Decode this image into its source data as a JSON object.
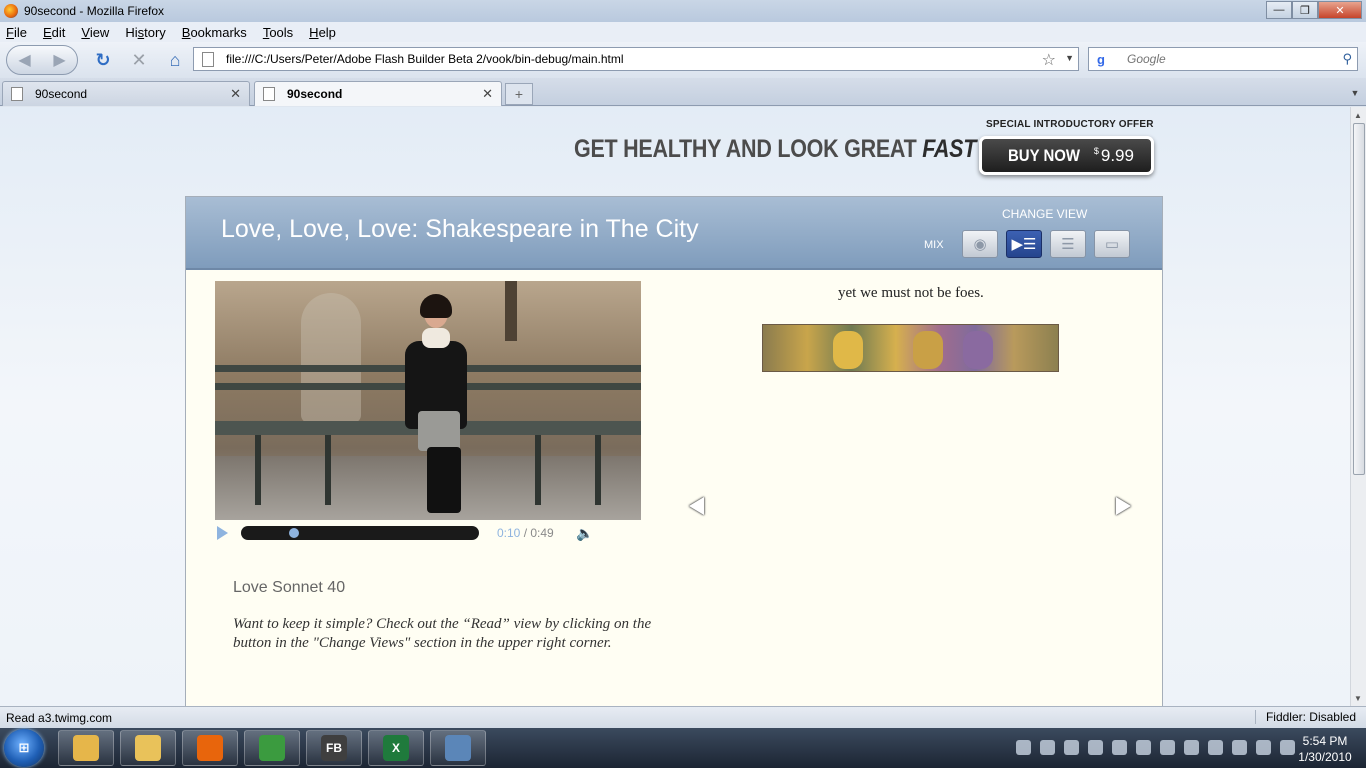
{
  "window": {
    "title": "90second - Mozilla Firefox"
  },
  "menu": {
    "items": [
      {
        "pre": "",
        "u": "F",
        "post": "ile"
      },
      {
        "pre": "",
        "u": "E",
        "post": "dit"
      },
      {
        "pre": "",
        "u": "V",
        "post": "iew"
      },
      {
        "pre": "Hi",
        "u": "s",
        "post": "tory"
      },
      {
        "pre": "",
        "u": "B",
        "post": "ookmarks"
      },
      {
        "pre": "",
        "u": "T",
        "post": "ools"
      },
      {
        "pre": "",
        "u": "H",
        "post": "elp"
      }
    ]
  },
  "nav": {
    "url": "file:///C:/Users/Peter/Adobe Flash Builder Beta 2/vook/bin-debug/main.html",
    "search_placeholder": "Google",
    "search_engine_icon": "google-icon"
  },
  "tabs": [
    {
      "label": "90second",
      "active": false
    },
    {
      "label": "90second",
      "active": true
    }
  ],
  "page": {
    "promo": {
      "main": "GET HEALTHY AND LOOK GREAT",
      "emph": "FAST"
    },
    "offer_label": "SPECIAL INTRODUCTORY OFFER",
    "buy": {
      "label": "BUY NOW",
      "currency": "$",
      "price": "9.99"
    },
    "panel": {
      "title": "Love, Love, Love: Shakespeare in The City",
      "change_view_label": "CHANGE VIEW",
      "mix_label": "MIX",
      "view_buttons": [
        {
          "name": "view-button-mix",
          "icon": "mix-view-icon",
          "glyph": "◉",
          "active": false
        },
        {
          "name": "view-button-split",
          "icon": "split-view-icon",
          "glyph": "▶☰",
          "active": true
        },
        {
          "name": "view-button-read",
          "icon": "read-view-icon",
          "glyph": "☰",
          "active": false
        },
        {
          "name": "view-button-watch",
          "icon": "watch-view-icon",
          "glyph": "▭",
          "active": false
        }
      ]
    },
    "video": {
      "current_time": "0:10",
      "separator": " / ",
      "duration": "0:49",
      "progress": 0.204
    },
    "sonnet_title": "Love Sonnet 40",
    "hint": "Want to keep it simple? Check out the “Read” view by clicking on the button in the \"Change Views\" section in the upper right corner.",
    "poem_line": "yet we must not be foes."
  },
  "status": {
    "text": "Read a3.twimg.com",
    "right": "Fiddler: Disabled"
  },
  "taskbar": {
    "start_label": "⊞",
    "apps": [
      {
        "name": "taskbar-explorer",
        "icon": "folder-icon",
        "color": "#e6b64a",
        "glyph": ""
      },
      {
        "name": "taskbar-outlook",
        "icon": "mail-icon",
        "color": "#e9c25a",
        "glyph": ""
      },
      {
        "name": "taskbar-firefox",
        "icon": "firefox-icon",
        "color": "#e8650c",
        "glyph": ""
      },
      {
        "name": "taskbar-chrome",
        "icon": "chrome-icon",
        "color": "#3b9b3f",
        "glyph": ""
      },
      {
        "name": "taskbar-flashbuilder",
        "icon": "flash-builder-icon",
        "color": "#3f3f3f",
        "glyph": "FB"
      },
      {
        "name": "taskbar-excel",
        "icon": "excel-icon",
        "color": "#1f7a3c",
        "glyph": "X"
      },
      {
        "name": "taskbar-window",
        "icon": "window-icon",
        "color": "#5b86b8",
        "glyph": ""
      }
    ],
    "time": "5:54 PM",
    "date": "1/30/2010"
  }
}
